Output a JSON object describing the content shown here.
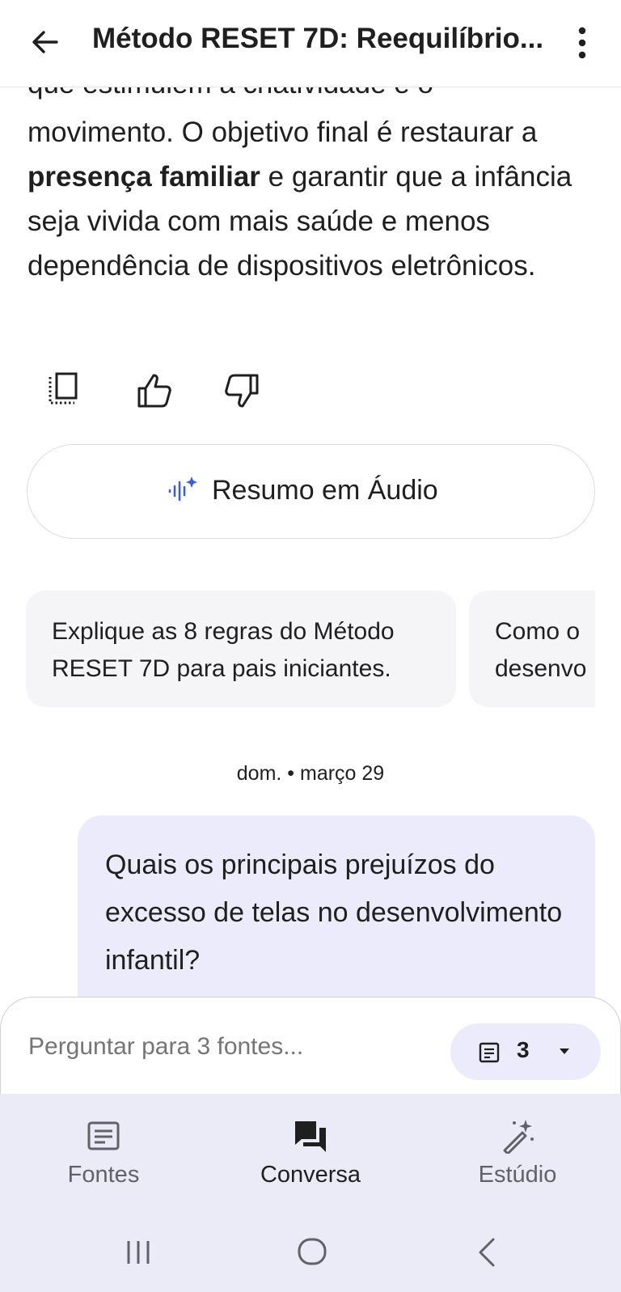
{
  "header": {
    "title": "Método RESET 7D: Reequilíbrio...",
    "back_icon": "arrow-left-icon",
    "menu_icon": "more-vert-icon"
  },
  "answer": {
    "clipped_line": "que estimulem a criatividade e o",
    "part1": "movimento. O objetivo final é restaurar a ",
    "bold": "presença familiar",
    "part2": " e garantir que a infância seja vivida com mais saúde e menos dependência de dispositivos eletrônicos."
  },
  "actions": [
    "copy-icon",
    "thumbs-up-icon",
    "thumbs-down-icon"
  ],
  "audio_button": {
    "label": "Resumo em Áudio",
    "icon": "audio-sparkle-icon"
  },
  "suggestions": [
    "Explique as 8 regras do Método RESET 7D para pais iniciantes.",
    "Como o desenvo"
  ],
  "date_separator": "dom. • março 29",
  "user_message": "Quais os principais prejuízos do excesso de telas no desenvolvimento infantil?",
  "composer": {
    "placeholder": "Perguntar para 3 fontes...",
    "sources_count": "3"
  },
  "bottom_nav": {
    "tabs": [
      {
        "label": "Fontes",
        "icon": "sources-icon"
      },
      {
        "label": "Conversa",
        "icon": "chat-icon"
      },
      {
        "label": "Estúdio",
        "icon": "magic-wand-icon"
      }
    ],
    "active": "Conversa"
  },
  "colors": {
    "accent": "#3c5bd9",
    "user_bubble": "#ebebfb",
    "chip_bg": "#f5f5f7",
    "nav_bg": "#ebebf8"
  }
}
